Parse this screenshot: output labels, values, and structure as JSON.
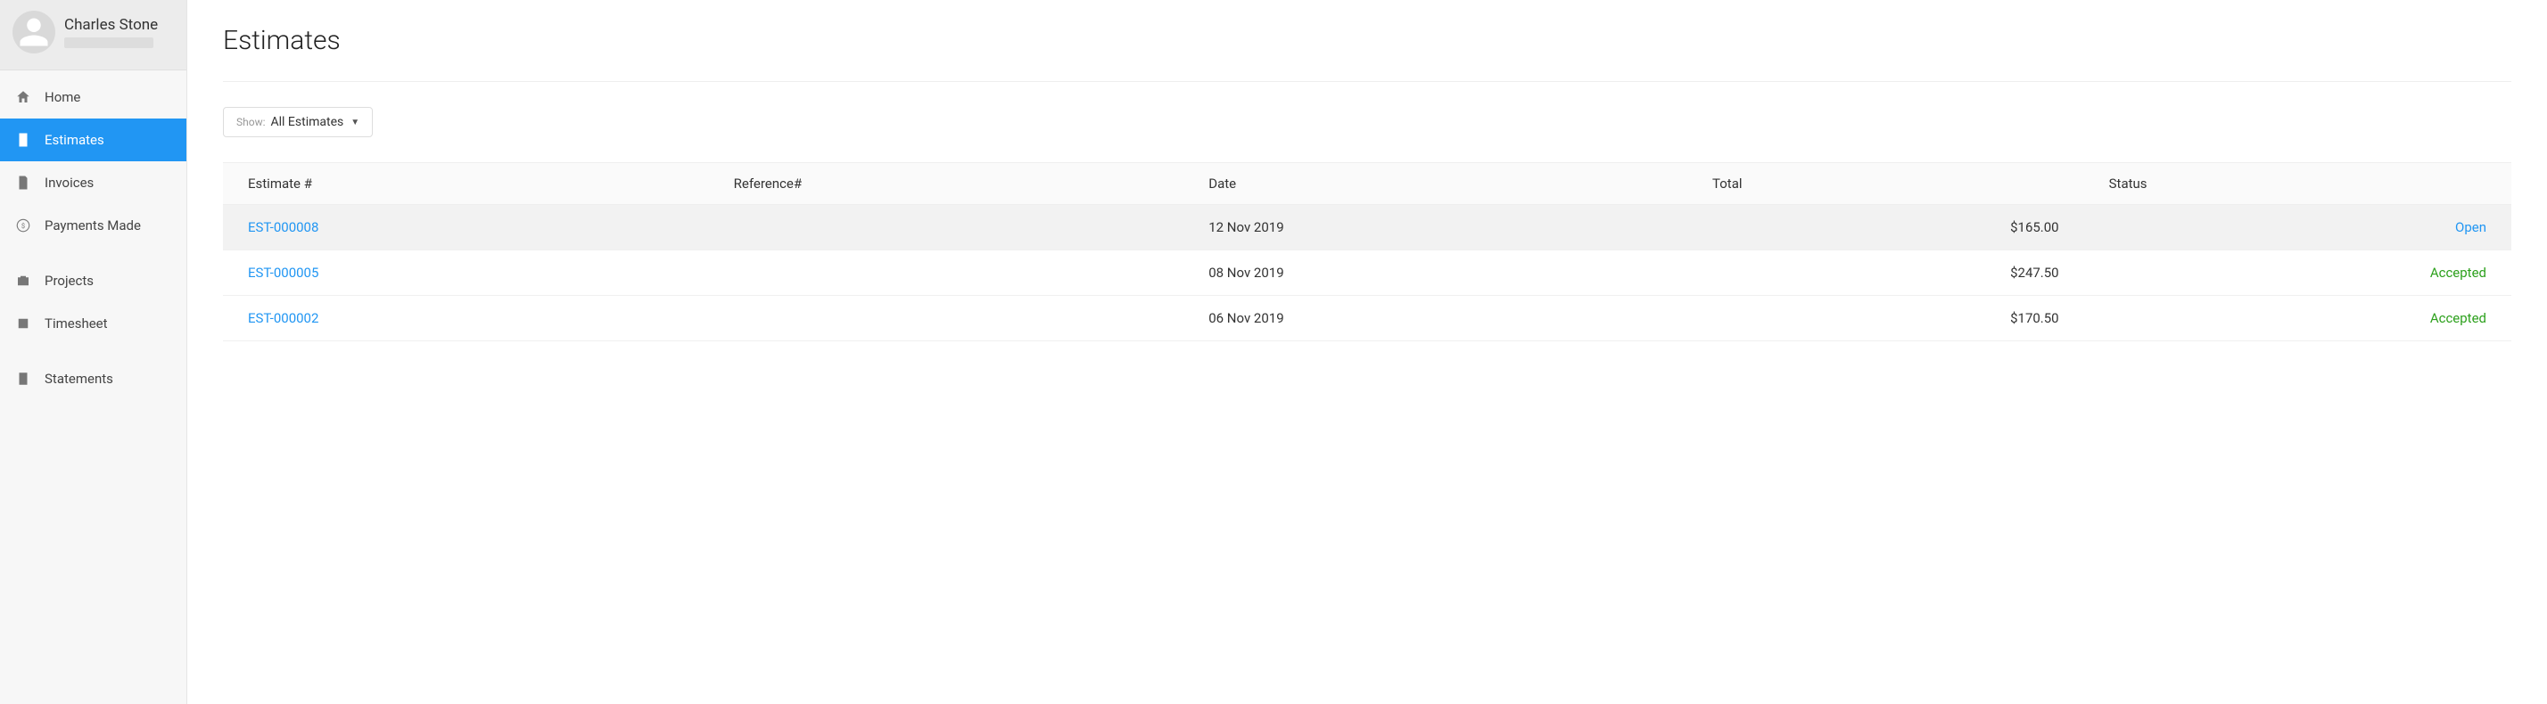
{
  "user": {
    "name": "Charles Stone"
  },
  "sidebar": {
    "items": [
      {
        "label": "Home"
      },
      {
        "label": "Estimates"
      },
      {
        "label": "Invoices"
      },
      {
        "label": "Payments Made"
      },
      {
        "label": "Projects"
      },
      {
        "label": "Timesheet"
      },
      {
        "label": "Statements"
      }
    ]
  },
  "page": {
    "title": "Estimates"
  },
  "filter": {
    "show_label": "Show:",
    "selected": "All Estimates"
  },
  "table": {
    "headers": {
      "estimate": "Estimate #",
      "reference": "Reference#",
      "date": "Date",
      "total": "Total",
      "status": "Status"
    },
    "rows": [
      {
        "estimate": "EST-000008",
        "reference": "",
        "date": "12 Nov 2019",
        "total": "$165.00",
        "status": "Open",
        "status_class": "status-open",
        "hover": true
      },
      {
        "estimate": "EST-000005",
        "reference": "",
        "date": "08 Nov 2019",
        "total": "$247.50",
        "status": "Accepted",
        "status_class": "status-accepted",
        "hover": false
      },
      {
        "estimate": "EST-000002",
        "reference": "",
        "date": "06 Nov 2019",
        "total": "$170.50",
        "status": "Accepted",
        "status_class": "status-accepted",
        "hover": false
      }
    ]
  }
}
